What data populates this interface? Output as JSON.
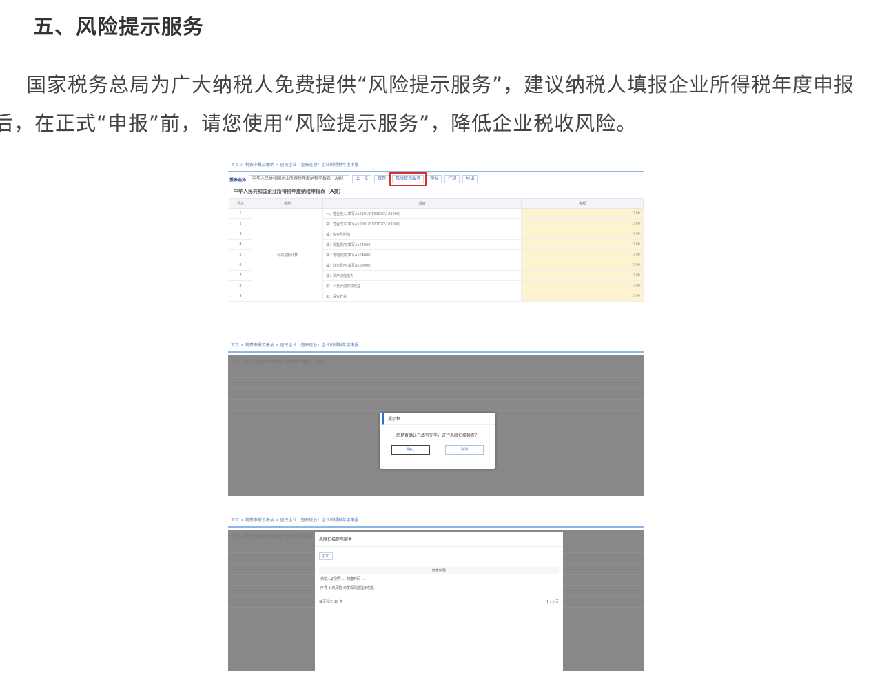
{
  "article": {
    "heading": "五、风险提示服务",
    "paragraph": "国家税务总局为广大纳税人免费提供“风险提示服务”，建议纳税人填报企业所得税年度申报后，在正式“申报”前，请您使用“风险提示服务”，降低企业税收风险。"
  },
  "screenshots": {
    "breadcrumb": "首页 > 税费申报及缴纳 > 居民企业（查账征收）企业所得税年度申报",
    "toolbar": {
      "label": "报表选择",
      "select_value": "中华人民共和国企业所得税年度纳税申报表（A类）",
      "buttons": [
        "上一张",
        "保存",
        "风险提示服务",
        "申报",
        "打印",
        "导出"
      ],
      "risk_button": "风险提示服务"
    },
    "form_title": "中华人民共和国企业所得税年度纳税申报表（A类）",
    "table": {
      "headers": [
        "行次",
        "类别",
        "项目",
        "金额"
      ],
      "category": "利润总额计算",
      "rows": [
        {
          "no": "1",
          "item": "一、营业收入(填写A101010\\101020\\103000)",
          "amount": "0.00"
        },
        {
          "no": "2",
          "item": "减：营业成本(填写A102010\\102020\\103000)",
          "amount": "0.00"
        },
        {
          "no": "3",
          "item": "减：税金及附加",
          "amount": "0.00"
        },
        {
          "no": "4",
          "item": "减：销售费用(填写A104000)",
          "amount": "0.00"
        },
        {
          "no": "5",
          "item": "减：管理费用(填写A104000)",
          "amount": "0.00"
        },
        {
          "no": "6",
          "item": "减：财务费用(填写A104000)",
          "amount": "0.00"
        },
        {
          "no": "7",
          "item": "减：资产减值损失",
          "amount": "0.00"
        },
        {
          "no": "8",
          "item": "加：公允价值变动收益",
          "amount": "0.00"
        },
        {
          "no": "9",
          "item": "加：投资收益",
          "amount": "0.00"
        }
      ]
    },
    "dialog": {
      "title": "提示框",
      "message": "您是否确认已填写完毕，进行风险扫描检查？",
      "ok": "确认",
      "cancel": "取消"
    },
    "result": {
      "title": "风险扫描提示服务",
      "print": "打印",
      "table_header": "检查结果",
      "row1": "纳税人识别号 ... 扫描时间 ...",
      "row2": "序号 1  无风险  未发现风险提示信息",
      "pager_left": "每页显示 10 条",
      "pager_right": "1 / 1 页"
    }
  }
}
